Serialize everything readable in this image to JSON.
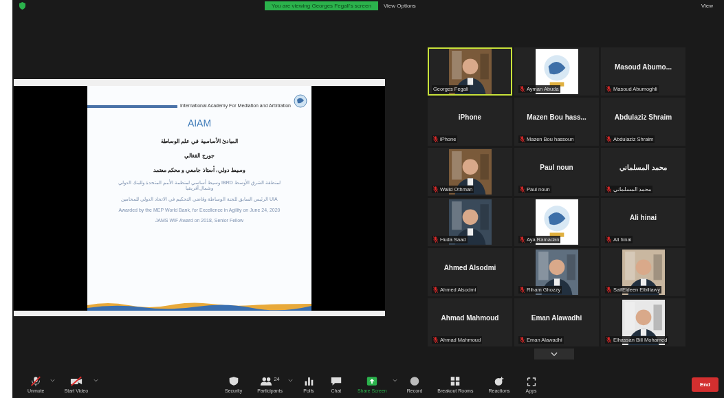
{
  "top_bar": {
    "banner": "You are viewing Georges Fegali's screen",
    "view_options": "View Options",
    "view": "View"
  },
  "shared_screen": {
    "header": "International Academy For Mediation and Arbitration",
    "title": "AIAM",
    "lines": [
      {
        "kind": "heading",
        "text": "المبادئ الأساسية في علم الوساطة"
      },
      {
        "kind": "heading",
        "text": "جورج الفغالي"
      },
      {
        "kind": "heading",
        "text": "وسيط دولي، أستاذ جامعي و محكم معتمد"
      },
      {
        "kind": "note",
        "text": "وسيط أساسي لمنظمة الأمم المتحدة وللبنك الدولي IBRD لمنطقة الشرق الأوسط وشمال أفريقيا"
      },
      {
        "kind": "note",
        "text": "الرئيس السابق للجنة الوساطة وقاضي التحكيم في الاتحاد الدولي للمحامين UIA"
      },
      {
        "kind": "note",
        "text": "Awarded by the MEP World Bank, for Excellence in Agility on June 24, 2020"
      },
      {
        "kind": "note",
        "text": "JAMS WIF Award on 2018, Senior Fellow"
      }
    ]
  },
  "participants": [
    {
      "kind": "video",
      "name": "Georges Fegali",
      "active_speaker": true,
      "muted": false
    },
    {
      "kind": "logo",
      "name": "Ayman Abuda",
      "active_speaker": false,
      "muted": true
    },
    {
      "kind": "name",
      "heading": "Masoud Abumo...",
      "name": "Masoud Abumoghli",
      "active_speaker": false,
      "muted": true
    },
    {
      "kind": "name",
      "heading": "iPhone",
      "name": "iPhone",
      "active_speaker": false,
      "muted": true
    },
    {
      "kind": "name",
      "heading": "Mazen Bou hass...",
      "name": "Mazen Bou hassoun",
      "active_speaker": false,
      "muted": true
    },
    {
      "kind": "name",
      "heading": "Abdulaziz Shraim",
      "name": "Abdulaziz Shraim",
      "active_speaker": false,
      "muted": true
    },
    {
      "kind": "video",
      "name": "Walid Othman",
      "active_speaker": false,
      "muted": true
    },
    {
      "kind": "name",
      "heading": "Paul noun",
      "name": "Paul noun",
      "active_speaker": false,
      "muted": true
    },
    {
      "kind": "name",
      "heading": "محمد المسلماني",
      "name": "محمد المسلماني",
      "active_speaker": false,
      "muted": true
    },
    {
      "kind": "video",
      "name": "Huda Saad",
      "active_speaker": false,
      "muted": true
    },
    {
      "kind": "logo",
      "name": "Aya Ramadan",
      "active_speaker": false,
      "muted": true
    },
    {
      "kind": "name",
      "heading": "Ali hinai",
      "name": "Ali hinai",
      "active_speaker": false,
      "muted": true
    },
    {
      "kind": "name",
      "heading": "Ahmed Alsodmi",
      "name": "Ahmed Alsodmi",
      "active_speaker": false,
      "muted": true
    },
    {
      "kind": "video",
      "name": "Riham Ghozzy",
      "active_speaker": false,
      "muted": true
    },
    {
      "kind": "video",
      "name": "SaifEldeen Elbiltawy",
      "active_speaker": false,
      "muted": true
    },
    {
      "kind": "name",
      "heading": "Ahmad Mahmoud",
      "name": "Ahmad Mahmoud",
      "active_speaker": false,
      "muted": true
    },
    {
      "kind": "name",
      "heading": "Eman Alawadhi",
      "name": "Eman Alawadhi",
      "active_speaker": false,
      "muted": true
    },
    {
      "kind": "video",
      "name": "Elhassan Bill Mohamed",
      "active_speaker": false,
      "muted": true
    }
  ],
  "toolbar": [
    {
      "kind": "mic",
      "label": "Unmute",
      "menu": true
    },
    {
      "kind": "camera",
      "label": "Start Video",
      "menu": true
    },
    {
      "kind": "security",
      "label": "Security",
      "menu": false
    },
    {
      "kind": "participants",
      "label": "Participants",
      "count": "24",
      "menu": true
    },
    {
      "kind": "polls",
      "label": "Polls",
      "menu": false
    },
    {
      "kind": "chat",
      "label": "Chat",
      "menu": false
    },
    {
      "kind": "share",
      "label": "Share Screen",
      "menu": true
    },
    {
      "kind": "record",
      "label": "Record",
      "menu": false
    },
    {
      "kind": "breakout",
      "label": "Breakout Rooms",
      "menu": false
    },
    {
      "kind": "reactions",
      "label": "Reactions",
      "menu": false
    },
    {
      "kind": "apps",
      "label": "Apps",
      "menu": false
    }
  ],
  "end_button": "End"
}
